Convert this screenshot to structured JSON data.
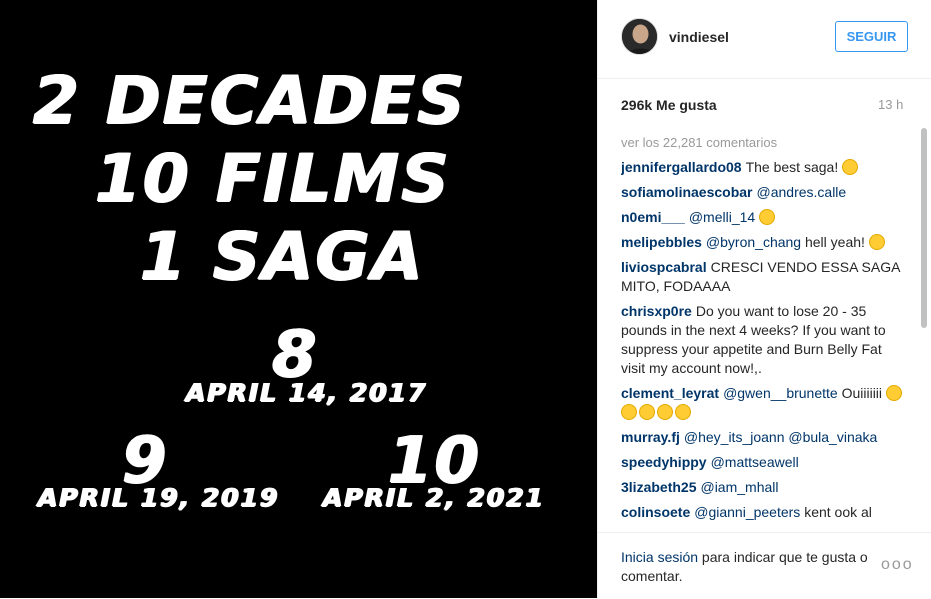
{
  "poster": {
    "line1": "2 DECADES",
    "line2": "10 FILMS",
    "line3": "1 SAGA",
    "film8_number": "8",
    "film8_date": "APRIL 14, 2017",
    "film9_number": "9",
    "film9_date": "APRIL 19, 2019",
    "film10_number": "10",
    "film10_date": "APRIL 2, 2021"
  },
  "header": {
    "username": "vindiesel",
    "follow_label": "SEGUIR"
  },
  "stats": {
    "likes": "296k Me gusta",
    "time": "13 h"
  },
  "comments": {
    "view_all": "ver los 22,281 comentarios",
    "items": [
      {
        "author": "jennifergallardo08",
        "mention": "",
        "text": "The best saga!",
        "emojis": 1
      },
      {
        "author": "sofiamolinaescobar",
        "mention": "@andres.calle",
        "text": "",
        "emojis": 0
      },
      {
        "author": "n0emi___",
        "mention": "@melli_14",
        "text": "",
        "emojis": 1
      },
      {
        "author": "melipebbles",
        "mention": "@byron_chang",
        "text": "hell yeah!",
        "emojis": 1
      },
      {
        "author": "liviospcabral",
        "mention": "",
        "text": "CRESCI VENDO ESSA SAGA MITO, FODAAAA",
        "emojis": 0
      },
      {
        "author": "chrisxp0re",
        "mention": "",
        "text": "Do you want to lose 20 - 35 pounds in the next 4 weeks? If you want to suppress your appetite and Burn Belly Fat visit my account now!,.",
        "emojis": 0
      },
      {
        "author": "clement_leyrat",
        "mention": "@gwen__brunette",
        "text": "Ouiiiiiii",
        "emojis": 5
      },
      {
        "author": "murray.fj",
        "mention": "@hey_its_joann @bula_vinaka",
        "text": "",
        "emojis": 0
      },
      {
        "author": "speedyhippy",
        "mention": "@mattseawell",
        "text": "",
        "emojis": 0
      },
      {
        "author": "3lizabeth25",
        "mention": "@iam_mhall",
        "text": "",
        "emojis": 0
      },
      {
        "author": "colinsoete",
        "mention": "@gianni_peeters",
        "text": "kent ook al",
        "emojis": 0
      }
    ]
  },
  "footer": {
    "login_link": "Inicia sesión",
    "login_text": " para indicar que te gusta o comentar.",
    "more_label": "ooo"
  },
  "colors": {
    "accent": "#3897f0",
    "link": "#003569",
    "muted": "#999999"
  },
  "icons": {
    "emoji": "smiley-emoji-icon",
    "more": "more-options-icon"
  }
}
